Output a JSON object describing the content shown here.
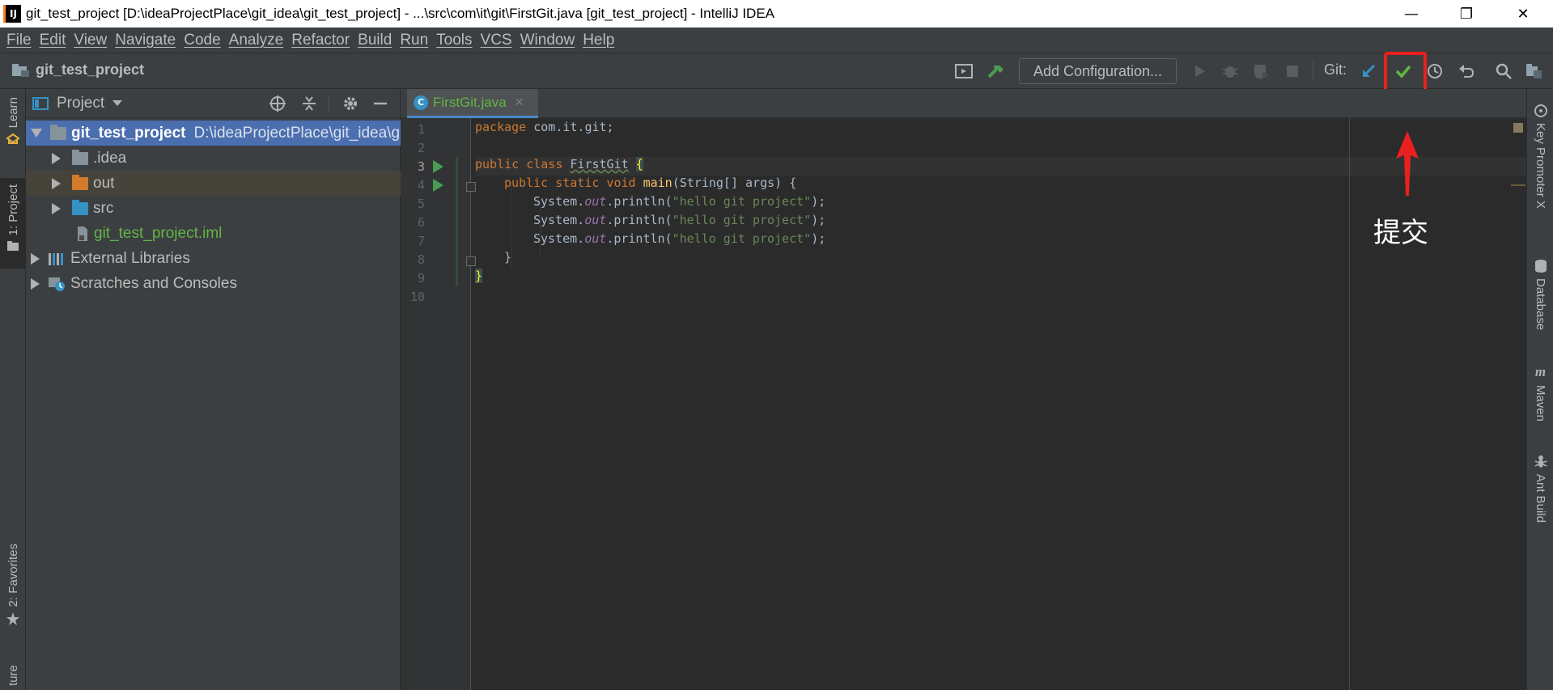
{
  "window": {
    "title": "git_test_project [D:\\ideaProjectPlace\\git_idea\\git_test_project] - ...\\src\\com\\it\\git\\FirstGit.java [git_test_project] - IntelliJ IDEA",
    "app_icon_text": "IJ",
    "controls": {
      "minimize": "—",
      "maximize": "❐",
      "close": "✕"
    }
  },
  "menu": [
    "File",
    "Edit",
    "View",
    "Navigate",
    "Code",
    "Analyze",
    "Refactor",
    "Build",
    "Run",
    "Tools",
    "VCS",
    "Window",
    "Help"
  ],
  "navbar": {
    "project_name": "git_test_project",
    "add_configuration": "Add Configuration...",
    "git_label": "Git:"
  },
  "left_strip": {
    "learn": "Learn",
    "project": "1: Project",
    "favorites": "2: Favorites",
    "structure": "ture"
  },
  "right_strip": {
    "key_promoter": "Key Promoter X",
    "database": "Database",
    "maven": "Maven",
    "ant_build": "Ant Build"
  },
  "project_panel": {
    "title": "Project",
    "tree": [
      {
        "label": "git_test_project",
        "path": "D:\\ideaProjectPlace\\git_idea\\g",
        "icon": "module-folder-icon"
      },
      {
        "label": ".idea",
        "icon": "folder-icon"
      },
      {
        "label": "out",
        "icon": "excluded-folder-icon"
      },
      {
        "label": "src",
        "icon": "source-folder-icon"
      },
      {
        "label": "git_test_project.iml",
        "icon": "iml-file-icon"
      },
      {
        "label": "External Libraries",
        "icon": "libraries-icon"
      },
      {
        "label": "Scratches and Consoles",
        "icon": "scratches-icon"
      }
    ]
  },
  "editor": {
    "tab_label": "FirstGit.java",
    "tab_icon_letter": "C",
    "line_numbers": [
      "1",
      "2",
      "3",
      "4",
      "5",
      "6",
      "7",
      "8",
      "9",
      "10"
    ],
    "code": {
      "l1_kw": "package",
      "l1_rest": " com.it.git;",
      "l3_kw": "public class",
      "l3_name": "FirstGit",
      "l3_brace": "{",
      "l4_kw": "public static void",
      "l4_method": "main",
      "l4_rest": "(String[] args) {",
      "sys": "System.",
      "out": "out",
      "println": ".println(",
      "str": "\"hello git project\"",
      "end": ");",
      "l8": "}",
      "l9": "}"
    }
  },
  "annotation": {
    "text": "提交"
  },
  "colors": {
    "accent_blue": "#4a88c7",
    "highlight_red": "#e8211e",
    "git_green": "#62b543"
  }
}
